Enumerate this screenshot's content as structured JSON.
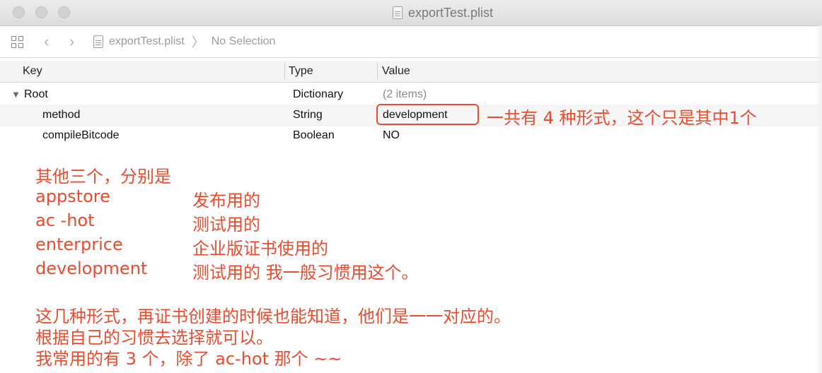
{
  "window": {
    "title": "exportTest.plist",
    "traffic_lights": [
      "close",
      "minimize",
      "zoom"
    ]
  },
  "navbar": {
    "related_items_icon": "grid-icon",
    "back_icon": "chevron-left-icon",
    "forward_icon": "chevron-right-icon",
    "file_name": "exportTest.plist",
    "selection": "No Selection"
  },
  "table": {
    "columns": [
      "Key",
      "Type",
      "Value"
    ],
    "rows": [
      {
        "key": "Root",
        "disclosure": "▼",
        "type": "Dictionary",
        "value": "(2 items)"
      },
      {
        "key": "method",
        "type": "String",
        "value": "development"
      },
      {
        "key": "compileBitcode",
        "type": "Boolean",
        "value": "NO"
      }
    ]
  },
  "annotation": {
    "side_note": "一共有 4 种形式，这个只是其中1个",
    "heading": "其他三个，分别是",
    "methods": [
      {
        "name": "appstore",
        "desc": "发布用的"
      },
      {
        "name": "ac -hot",
        "desc": "测试用的"
      },
      {
        "name": "enterprice",
        "desc": "企业版证书使用的"
      },
      {
        "name": "development",
        "desc": "测试用的  我一般习惯用这个。"
      }
    ],
    "para1": "这几种形式，再证书创建的时候也能知道，他们是一一对应的。",
    "para2": "根据自己的习惯去选择就可以。",
    "para3": "我常用的有 3 个，除了 ac-hot 那个 ~~"
  },
  "colors": {
    "annotation_red": "#ec4b2e",
    "header_bg": "#f4f4f4",
    "titlebar_bg": "#dcdcdc"
  }
}
